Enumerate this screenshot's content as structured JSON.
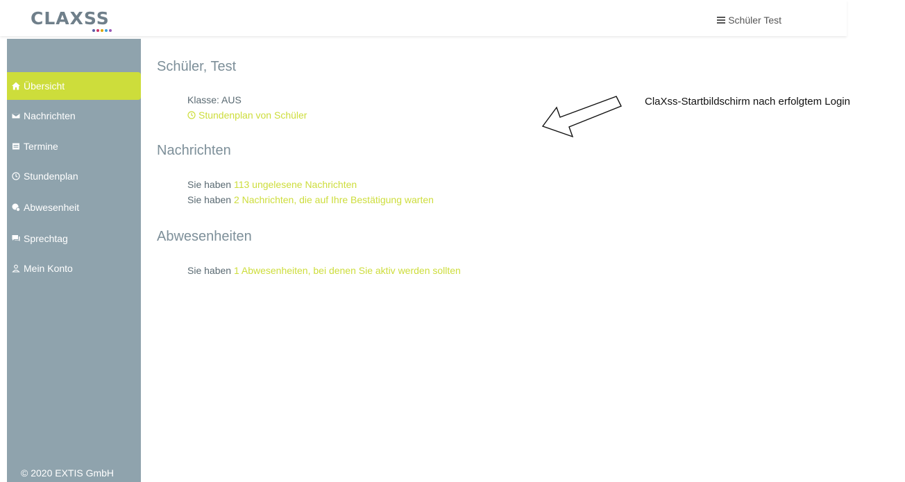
{
  "header": {
    "logo_text": "CLAXSS",
    "logo_dot_colors": [
      "#5b5ea6",
      "#cc3366",
      "#d9a400",
      "#3aa0d8",
      "#9b59b6"
    ],
    "user_menu_label": "Schüler Test",
    "user_menu_icon": "hamburger-icon"
  },
  "sidebar": {
    "active_color": "#cddd3b",
    "background_color": "#8fa3ad",
    "items": [
      {
        "label": "Übersicht",
        "icon": "home-icon",
        "active": true
      },
      {
        "label": "Nachrichten",
        "icon": "envelope-icon",
        "active": false
      },
      {
        "label": "Termine",
        "icon": "calendar-icon",
        "active": false
      },
      {
        "label": "Stundenplan",
        "icon": "clock-icon",
        "active": false
      },
      {
        "label": "Abwesenheit",
        "icon": "absence-icon",
        "active": false
      },
      {
        "label": "Sprechtag",
        "icon": "chat-icon",
        "active": false
      },
      {
        "label": "Mein Konto",
        "icon": "user-icon",
        "active": false
      }
    ],
    "footer": "© 2020 EXTIS GmbH"
  },
  "main": {
    "student_title": "Schüler, Test",
    "class_label": "Klasse: AUS",
    "timetable_link": "Stundenplan von Schüler",
    "messages_title": "Nachrichten",
    "messages_line1_prefix": "Sie haben ",
    "messages_line1_link": "113 ungelesene Nachrichten",
    "messages_line2_prefix": "Sie haben ",
    "messages_line2_link": "2 Nachrichten, die auf Ihre Bestätigung warten",
    "absences_title": "Abwesenheiten",
    "absences_line_prefix": "Sie haben ",
    "absences_line_link": "1 Abwesenheiten, bei denen Sie aktiv werden sollten"
  },
  "annotation": {
    "text": "ClaXss-Startbildschirm nach erfolgtem Login"
  }
}
